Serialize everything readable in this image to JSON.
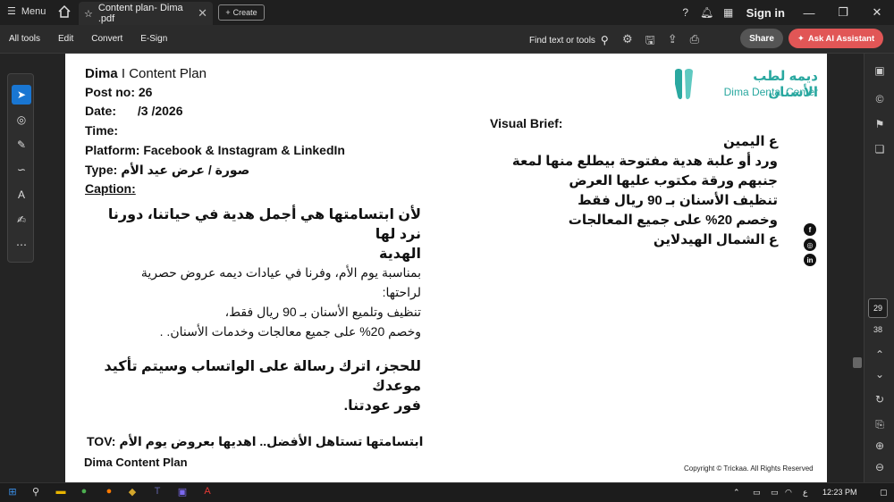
{
  "tabbar": {
    "menu_label": "Menu",
    "tab_title": "Content plan- Dima .pdf",
    "create_label": "Create",
    "signin_label": "Sign in"
  },
  "toolbar": {
    "menus": [
      "All tools",
      "Edit",
      "Convert",
      "E-Sign"
    ],
    "find_label": "Find text or tools",
    "share_label": "Share",
    "ai_label": "Ask AI Assistant"
  },
  "doc": {
    "header_name": "Dima",
    "header_sep": "I",
    "header_rest": "Content Plan",
    "post_no": "Post no: 26",
    "date_label": "Date:",
    "date_value": "/3 /2026",
    "time_label": "Time:",
    "platform": "Platform: Facebook & Instagram & LinkedIn",
    "type_label": "Type:",
    "type_value": "صورة / عرض عيد الأم",
    "caption_label": "Caption:",
    "caption_head_1": "لأن ابتسامتها هي أجمل هدية في حياتنا، دورنا نرد لها",
    "caption_head_2": "الهدية",
    "caption_body_1": "بمناسبة يوم الأم، وفرنا في عيادات ديمه عروض حصرية",
    "caption_body_2": "لراحتها:",
    "caption_body_3": "تنظيف وتلميع الأسنان بـ 90 ريال فقط،",
    "caption_body_4": "وخصم 20% على جميع معالجات وخدمات الأسنان. .",
    "cta_1": "للحجز، اترك رسالة على الواتساب وسيتم تأكيد موعدك",
    "cta_2": "فور عودتنا.",
    "tov": "TOV: ابتسامتها تستاهل الأفضل.. اهديها بعروض يوم الأم",
    "footer_name": "Dima Content Plan",
    "visual_brief": "Visual Brief:",
    "brief_lines": [
      "ع اليمين",
      "ورد أو علبة هدية مفتوحة بيطلع منها لمعة",
      "جنبهم ورقة مكتوب عليها العرض",
      "تنظيف الأسنان بـ 90 ريال فقط",
      "وخصم 20% على جميع المعالجات",
      "ع الشمال الهيدلاين"
    ],
    "logo_ar": "ديمه لطب الأسنان",
    "logo_en": "Dima Dental Center",
    "copyright": "Copyright © Trickaa. All Rights Reserved"
  },
  "nav": {
    "current_page": "29",
    "total_pages": "38"
  },
  "taskbar": {
    "lang": "ع",
    "time": "12:23 PM"
  },
  "colors": {
    "accent": "#1976d2",
    "ai_button": "#e15656",
    "logo_teal": "#2aa8a0"
  }
}
